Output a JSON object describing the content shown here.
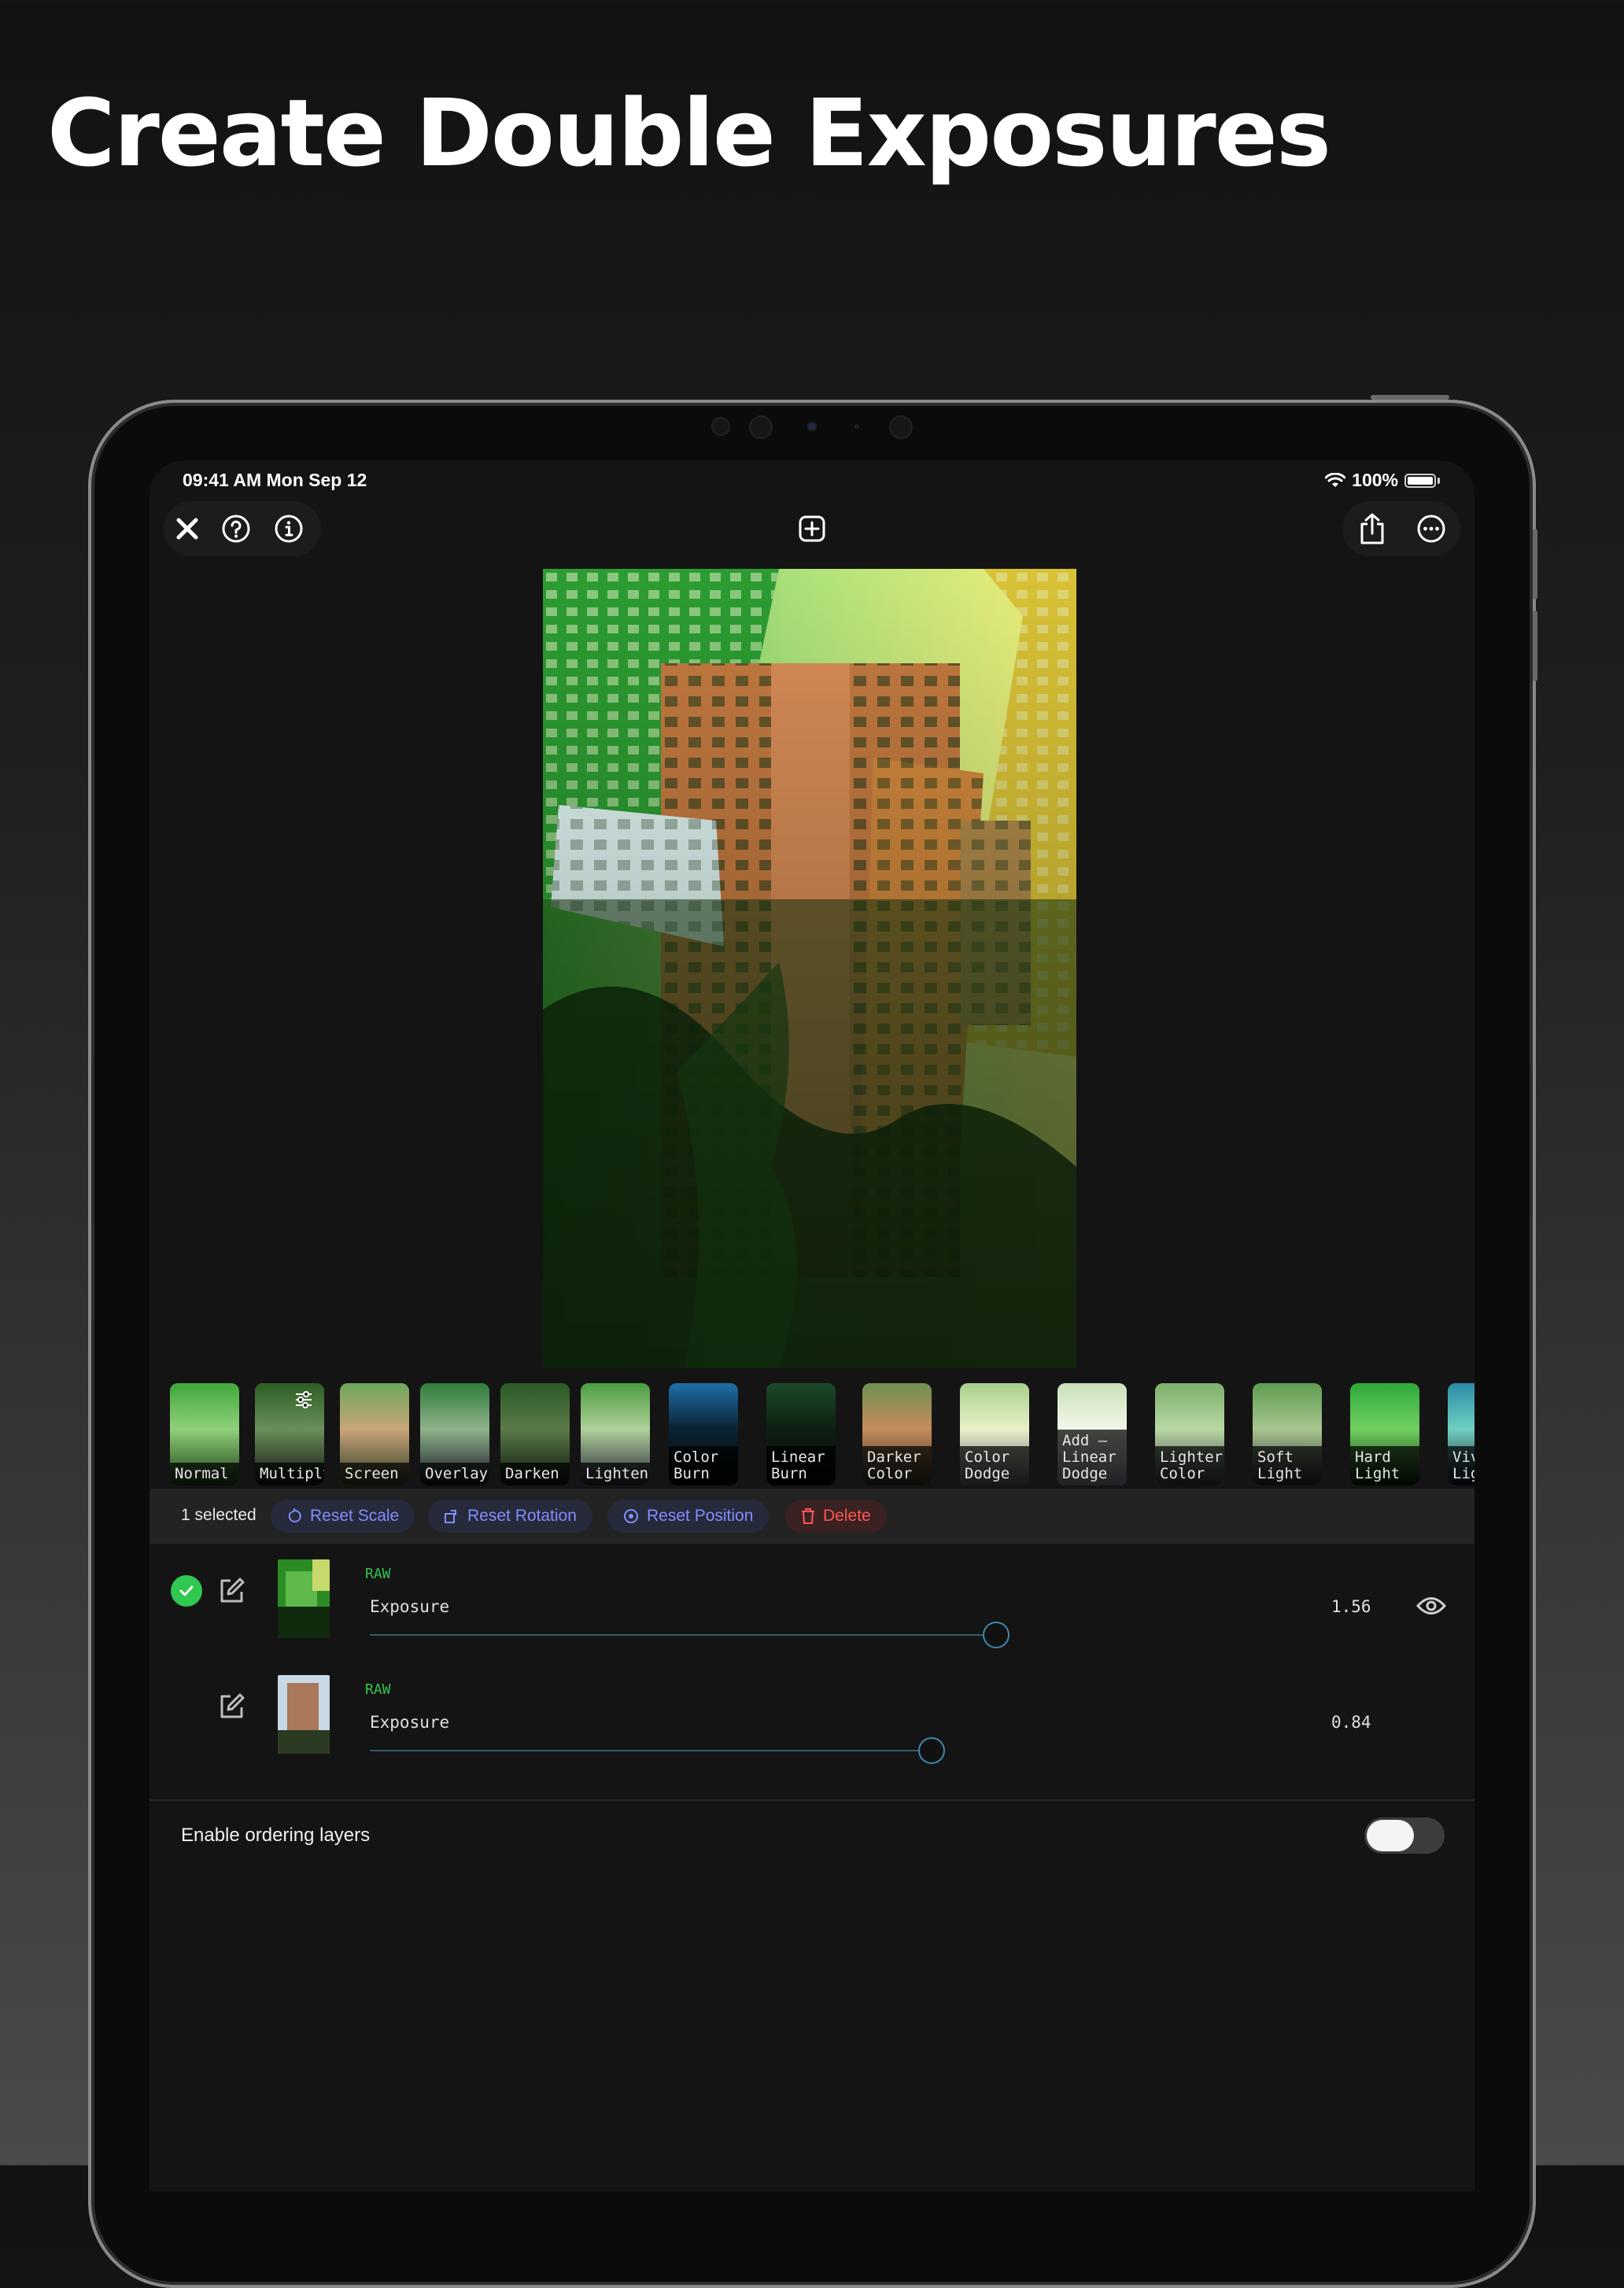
{
  "headline": "Create Double Exposures",
  "status_bar": {
    "time": "09:41 AM Mon Sep 12",
    "battery": "100%"
  },
  "toolbar": {
    "left_icons": [
      "close-icon",
      "help-icon",
      "info-icon"
    ],
    "center_icon": "add-layer-icon",
    "right_icons": [
      "share-icon",
      "more-icon"
    ]
  },
  "blend_modes": [
    {
      "label": "Normal",
      "selected": false
    },
    {
      "label": "Multiply",
      "selected": true
    },
    {
      "label": "Screen",
      "selected": false
    },
    {
      "label": "Overlay",
      "selected": false
    },
    {
      "label": "Darken",
      "selected": false
    },
    {
      "label": "Lighten",
      "selected": false
    },
    {
      "label": "Color\nBurn",
      "selected": false
    },
    {
      "label": "Linear\nBurn",
      "selected": false
    },
    {
      "label": "Darker\nColor",
      "selected": false
    },
    {
      "label": "Color\nDodge",
      "selected": false
    },
    {
      "label": "Add –\nLinear\nDodge",
      "selected": false
    },
    {
      "label": "Lighter\nColor",
      "selected": false
    },
    {
      "label": "Soft\nLight",
      "selected": false
    },
    {
      "label": "Hard\nLight",
      "selected": false
    },
    {
      "label": "Viv\nLig",
      "selected": false
    }
  ],
  "actions": {
    "selected_count": "1 selected",
    "reset_scale": "Reset Scale",
    "reset_rotation": "Reset Rotation",
    "reset_position": "Reset Position",
    "delete": "Delete"
  },
  "layers": [
    {
      "tag": "RAW",
      "param": "Exposure",
      "value": "1.56",
      "level": 0.78,
      "checked": true,
      "visible_icon": "eye-icon"
    },
    {
      "tag": "RAW",
      "param": "Exposure",
      "value": "0.84",
      "level": 0.7,
      "checked": false
    }
  ],
  "ordering": {
    "label": "Enable ordering layers",
    "enabled": false
  },
  "colors": {
    "accent_blue": "#7f8eff",
    "delete_red": "#ff5555",
    "check_green": "#2fc850",
    "raw_green": "#37c24e"
  }
}
